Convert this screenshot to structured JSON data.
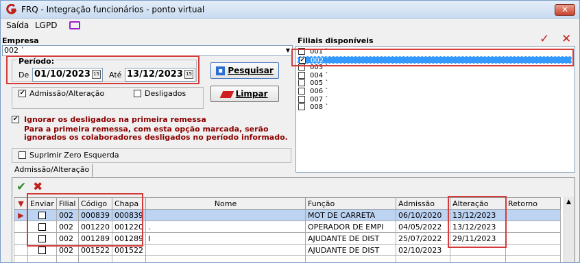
{
  "window": {
    "title": "FRQ - Integração funcionários - ponto virtual",
    "close": "✕"
  },
  "menu": {
    "items": [
      "Saída",
      "LGPD"
    ]
  },
  "empresa": {
    "label": "Empresa",
    "value": "002 `"
  },
  "periodo": {
    "label": "Período:",
    "de_label": "De",
    "de_value": "01/10/2023",
    "ate_label": "Até",
    "ate_value": "13/12/2023"
  },
  "options": {
    "admissao_label": "Admissão/Alteração",
    "admissao_checked": true,
    "desligados_label": "Desligados",
    "desligados_checked": false
  },
  "buttons": {
    "pesquisar": "Pesquisar",
    "limpar": "Limpar"
  },
  "ignorar": {
    "label": "Ignorar os desligados na primeira remessa",
    "note_line1": "Para a primeira remessa, com esta opção marcada, serão",
    "note_line2": "ignorados os colaboradores desligados no período informado."
  },
  "suprimir": {
    "label": "Suprimir Zero Esquerda",
    "checked": false
  },
  "filiais": {
    "label": "Filiais disponíveis",
    "items": [
      {
        "code": "001 `",
        "checked": false,
        "selected": false
      },
      {
        "code": "002 `",
        "checked": true,
        "selected": true
      },
      {
        "code": "003 `",
        "checked": false,
        "selected": false
      },
      {
        "code": "004 `",
        "checked": false,
        "selected": false
      },
      {
        "code": "005 `",
        "checked": false,
        "selected": false
      },
      {
        "code": "006 `",
        "checked": false,
        "selected": false
      },
      {
        "code": "007 `",
        "checked": false,
        "selected": false
      },
      {
        "code": "008 `",
        "checked": false,
        "selected": false
      }
    ]
  },
  "tab": {
    "label": "Admissão/Alteração"
  },
  "grid": {
    "columns": [
      "Enviar",
      "Filial",
      "Código",
      "Chapa",
      "Nome",
      "Função",
      "Admissão",
      "Alteração",
      "Retorno"
    ],
    "rows": [
      {
        "filial": "002",
        "codigo": "000839",
        "chapa": "000839",
        "nome": "",
        "funcao": "MOT DE CARRETA",
        "admissao": "06/10/2020",
        "alteracao": "13/12/2023",
        "retorno": "",
        "selected": true
      },
      {
        "filial": "002",
        "codigo": "001220",
        "chapa": "001220",
        "nome": ".",
        "funcao": "OPERADOR DE EMPI",
        "admissao": "04/05/2022",
        "alteracao": "13/12/2023",
        "retorno": "",
        "selected": false
      },
      {
        "filial": "002",
        "codigo": "001289",
        "chapa": "001289",
        "nome": "I",
        "funcao": "AJUDANTE DE DIST",
        "admissao": "25/07/2022",
        "alteracao": "29/11/2023",
        "retorno": "",
        "selected": false
      },
      {
        "filial": "002",
        "codigo": "001522",
        "chapa": "001522",
        "nome": "",
        "funcao": "AJUDANTE DE DIST",
        "admissao": "02/10/2023",
        "alteracao": "",
        "retorno": "",
        "selected": false
      }
    ]
  },
  "colors": {
    "check_green": "#2e8b2e",
    "x_red": "#c0201a",
    "highlight": "#d43b3b"
  }
}
